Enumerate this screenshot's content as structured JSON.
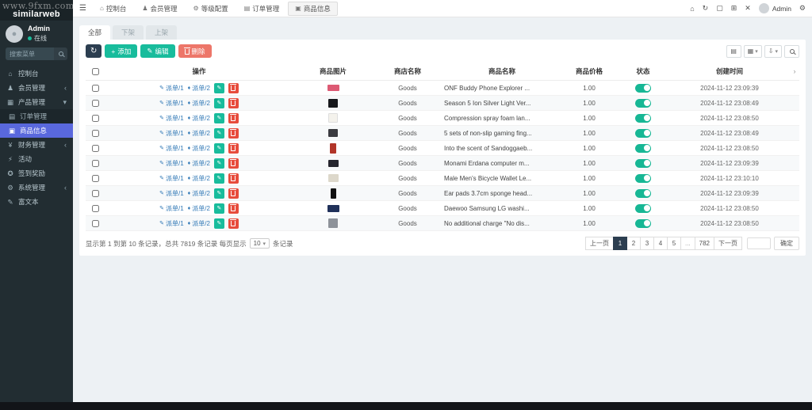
{
  "watermark": "www.9fxm.com",
  "sidebar": {
    "logo": "similarweb",
    "user": {
      "name": "Admin",
      "status": "在线"
    },
    "search_placeholder": "搜索菜单",
    "menu": [
      {
        "label": "控制台",
        "icon": "⌂",
        "chev": "",
        "cls": "menu-item"
      },
      {
        "label": "会员管理",
        "icon": "♟",
        "chev": "‹",
        "cls": "menu-item"
      },
      {
        "label": "产品管理",
        "icon": "▦",
        "chev": "▾",
        "cls": "menu-item"
      },
      {
        "label": "订单管理",
        "icon": "▤",
        "chev": "",
        "cls": "menu-item sub"
      },
      {
        "label": "商品信息",
        "icon": "▣",
        "chev": "",
        "cls": "menu-item sub active"
      },
      {
        "label": "财务管理",
        "icon": "¥",
        "chev": "‹",
        "cls": "menu-item"
      },
      {
        "label": "活动",
        "icon": "⚡",
        "chev": "",
        "cls": "menu-item"
      },
      {
        "label": "签到奖励",
        "icon": "✪",
        "chev": "",
        "cls": "menu-item"
      },
      {
        "label": "系统管理",
        "icon": "⚙",
        "chev": "‹",
        "cls": "menu-item"
      },
      {
        "label": "富文本",
        "icon": "✎",
        "chev": "",
        "cls": "menu-item"
      }
    ]
  },
  "topnav": {
    "hamburger": "☰",
    "tabs": [
      {
        "label": "控制台",
        "icon": "⌂",
        "cls": "ttab"
      },
      {
        "label": "会员管理",
        "icon": "♟",
        "cls": "ttab"
      },
      {
        "label": "等级配置",
        "icon": "⚙",
        "cls": "ttab"
      },
      {
        "label": "订单管理",
        "icon": "▤",
        "cls": "ttab"
      },
      {
        "label": "商品信息",
        "icon": "▣",
        "cls": "ttab active"
      }
    ],
    "right": {
      "home": "⌂",
      "refresh": "↻",
      "win": "▢",
      "wins": "⊞",
      "full": "✕",
      "gear": "⚙"
    },
    "user": "Admin"
  },
  "filter_tabs": [
    {
      "label": "全部",
      "cls": "ftab active"
    },
    {
      "label": "下架",
      "cls": "ftab"
    },
    {
      "label": "上架",
      "cls": "ftab"
    }
  ],
  "toolbar": {
    "refresh_icon": "↻",
    "plus": "+",
    "add": "添加",
    "pencil": "✎",
    "edit": "编辑",
    "delete": "删除",
    "icon_list": "▤",
    "icon_grid": "▦",
    "icon_export": "⇩",
    "caret": "▾"
  },
  "table": {
    "headers": [
      "操作",
      "商品图片",
      "商店名称",
      "商品名称",
      "商品价格",
      "状态",
      "创建时间"
    ],
    "header_arrow": "›",
    "link1_icon": "✎",
    "link1": "派单/1",
    "link2_icon": "♦",
    "link2": "派单/2",
    "rows": [
      {
        "shop": "Goods",
        "name": "ONF Buddy Phone Explorer ...",
        "price": "1.00",
        "time": "2024-11-12 23:09:39",
        "thumb_style": "background:#dd5a74;width:15px;height:8px"
      },
      {
        "shop": "Goods",
        "name": "Season 5 Ion Silver Light Ver...",
        "price": "1.00",
        "time": "2024-11-12 23:08:49",
        "thumb_style": "background:#17181c;width:12px;height:11px"
      },
      {
        "shop": "Goods",
        "name": "Compression spray foam lan...",
        "price": "1.00",
        "time": "2024-11-12 23:08:50",
        "thumb_style": "background:#f4f2ec;width:12px;height:12px;border:1px solid #ddd"
      },
      {
        "shop": "Goods",
        "name": "5 sets of non-slip gaming fing...",
        "price": "1.00",
        "time": "2024-11-12 23:08:49",
        "thumb_style": "background:#3b3b40;width:12px;height:10px"
      },
      {
        "shop": "Goods",
        "name": "Into the scent of Sandoggaeb...",
        "price": "1.00",
        "time": "2024-11-12 23:08:50",
        "thumb_style": "background:#b23529;width:8px;height:13px"
      },
      {
        "shop": "Goods",
        "name": "Monami Erdana computer m...",
        "price": "1.00",
        "time": "2024-11-12 23:09:39",
        "thumb_style": "background:#26262e;width:13px;height:9px"
      },
      {
        "shop": "Goods",
        "name": "Male Men's Bicycle Wallet Le...",
        "price": "1.00",
        "time": "2024-11-12 23:10:10",
        "thumb_style": "background:#ddd8cb;width:13px;height:10px"
      },
      {
        "shop": "Goods",
        "name": "Ear pads 3.7cm sponge head...",
        "price": "1.00",
        "time": "2024-11-12 23:09:39",
        "thumb_style": "background:#111111;width:7px;height:13px"
      },
      {
        "shop": "Goods",
        "name": "Daewoo Samsung LG washi...",
        "price": "1.00",
        "time": "2024-11-12 23:08:50",
        "thumb_style": "background:#20315a;width:15px;height:9px"
      },
      {
        "shop": "Goods",
        "name": "No additional charge \"No dis...",
        "price": "1.00",
        "time": "2024-11-12 23:08:50",
        "thumb_style": "background:#8e939a;width:12px;height:12px"
      }
    ]
  },
  "footer": {
    "summary_prefix": "显示第 1 到第 10 条记录，总共 7819 条记录 每页显示",
    "page_size": "10",
    "caret": "▾",
    "summary_suffix": "条记录",
    "pages": [
      {
        "label": "上一页",
        "cls": "pg"
      },
      {
        "label": "1",
        "cls": "pg active"
      },
      {
        "label": "2",
        "cls": "pg"
      },
      {
        "label": "3",
        "cls": "pg"
      },
      {
        "label": "4",
        "cls": "pg"
      },
      {
        "label": "5",
        "cls": "pg"
      },
      {
        "label": "...",
        "cls": "pg dots"
      },
      {
        "label": "782",
        "cls": "pg"
      },
      {
        "label": "下一页",
        "cls": "pg"
      }
    ],
    "confirm": "确定"
  },
  "colors": {
    "accent_blue": "#5968dd",
    "teal": "#18bc9c",
    "danger": "#e74c3c",
    "dark_button": "#2c3e50",
    "sidebar_bg": "#222d32"
  }
}
